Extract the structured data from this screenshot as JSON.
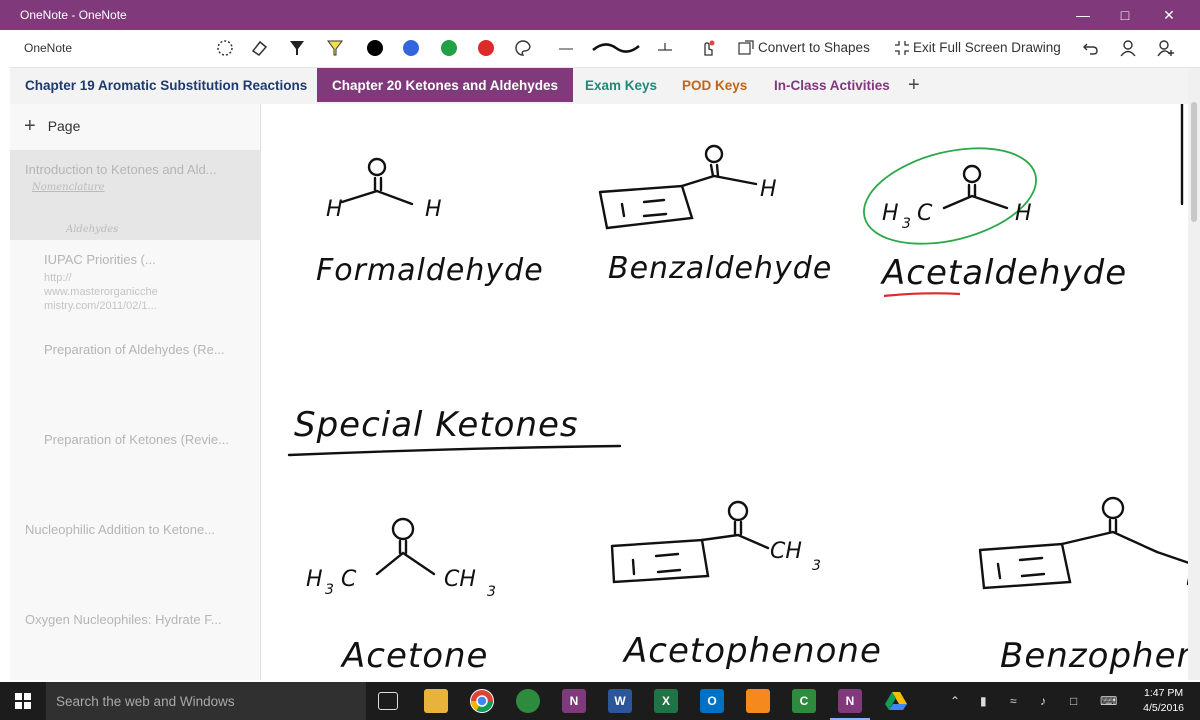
{
  "window": {
    "title": "OneNote - OneNote"
  },
  "ribbon": {
    "app_name": "OneNote",
    "convert_label": "Convert to Shapes",
    "exit_label": "Exit Full Screen Drawing",
    "pen_colors": [
      "#000000",
      "#3366dd",
      "#22a045",
      "#dd2a2a"
    ]
  },
  "tabs": [
    {
      "label": "Chapter 19 Aromatic Substitution Reactions",
      "color": "#1f3a6e"
    },
    {
      "label": "Chapter 20 Ketones and Aldehydes",
      "color": "#ffffff"
    },
    {
      "label": "Exam Keys",
      "color": "#1e8a78"
    },
    {
      "label": "POD Keys",
      "color": "#c0661a"
    },
    {
      "label": "In-Class Activities",
      "color": "#80397B"
    }
  ],
  "pages": {
    "add_label": "Page",
    "items": [
      {
        "title": "Introduction to Ketones and Ald...",
        "note1": "Nomenclature",
        "note2": "Aldehydes"
      },
      {
        "title": "IUPAC Priorities (...",
        "sub1": "http://",
        "sub2": "www.masterorganicche",
        "sub3": "mistry.com/2011/02/1..."
      },
      {
        "title": "Preparation of Aldehydes (Re..."
      },
      {
        "title": "Preparation of Ketones (Revie..."
      },
      {
        "title": "Nucleophilic Addition to Ketone..."
      },
      {
        "title": "Oxygen Nucleophiles: Hydrate F..."
      }
    ]
  },
  "canvas": {
    "aldehydes": [
      "Formaldehyde",
      "Benzaldehyde",
      "Acetaldehyde"
    ],
    "heading": "Special Ketones",
    "ketones": [
      "Acetone",
      "Acetophenone",
      "Benzophenone"
    ]
  },
  "taskbar": {
    "search_placeholder": "Search the web and Windows",
    "time": "1:47 PM",
    "date": "4/5/2016"
  }
}
